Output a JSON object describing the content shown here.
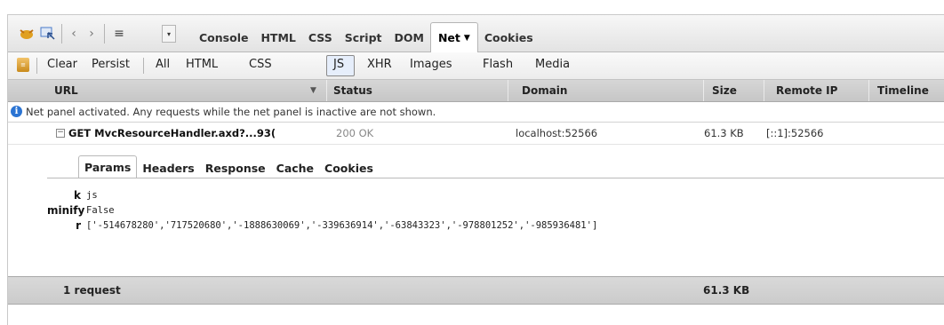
{
  "toolbar": {
    "tabs": [
      "Console",
      "HTML",
      "CSS",
      "Script",
      "DOM",
      "Net",
      "Cookies"
    ],
    "active_tab": "Net"
  },
  "net_toolbar": {
    "items": [
      "Clear",
      "Persist",
      "All",
      "HTML",
      "CSS",
      "JS",
      "XHR",
      "Images",
      "Flash",
      "Media"
    ],
    "active_filter": "JS"
  },
  "columns": {
    "url": "URL",
    "status": "Status",
    "domain": "Domain",
    "size": "Size",
    "remote_ip": "Remote IP",
    "timeline": "Timeline"
  },
  "info_message": "Net panel activated. Any requests while the net panel is inactive are not shown.",
  "request": {
    "url": "GET MvcResourceHandler.axd?...93(",
    "status": "200 OK",
    "domain": "localhost:52566",
    "size": "61.3 KB",
    "remote_ip": "[::1]:52566"
  },
  "detail_tabs": [
    "Params",
    "Headers",
    "Response",
    "Cache",
    "Cookies"
  ],
  "params": [
    {
      "key": "k",
      "value": "js"
    },
    {
      "key": "minify",
      "value": "False"
    },
    {
      "key": "r",
      "value": "['-514678280','717520680','-1888630069','-339636914','-63843323','-978801252','-985936481']"
    }
  ],
  "summary": {
    "requests": "1 request",
    "size": "61.3 KB"
  },
  "colors": {
    "info_icon": "#2b74d3",
    "header_bg": "#cfcfcf"
  }
}
